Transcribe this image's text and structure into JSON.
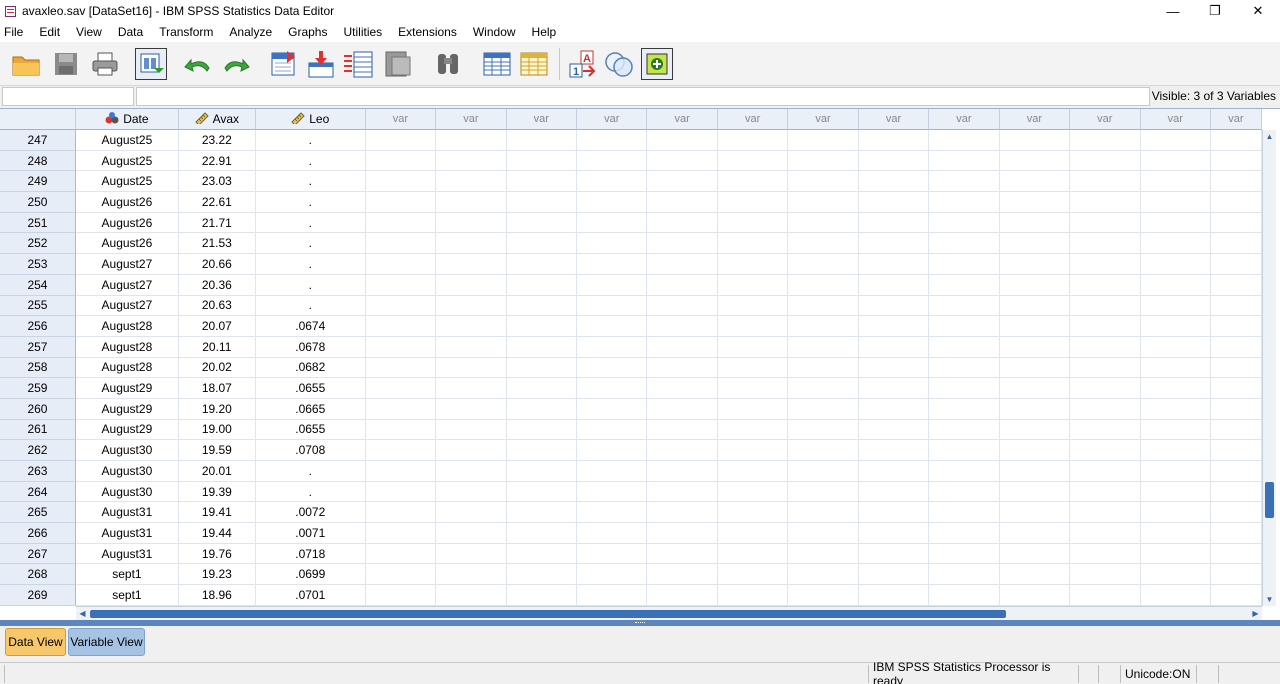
{
  "window": {
    "title": "avaxleo.sav [DataSet16] - IBM SPSS Statistics Data Editor",
    "controls": [
      "—",
      "❐",
      "✕"
    ]
  },
  "menu": [
    "File",
    "Edit",
    "View",
    "Data",
    "Transform",
    "Analyze",
    "Graphs",
    "Utilities",
    "Extensions",
    "Window",
    "Help"
  ],
  "toolbar": {
    "icons": [
      "open-folder-icon",
      "save-icon",
      "print-icon",
      "dialog-recall-icon",
      "undo-icon",
      "redo-icon",
      "go-to-case-icon",
      "go-to-variable-icon",
      "variables-icon",
      "run-descriptives-icon",
      "find-icon",
      "insert-cases-icon",
      "insert-variable-icon",
      "value-labels-icon",
      "use-sets-icon",
      "spelling-icon"
    ]
  },
  "cell_editor": {
    "name_value": "",
    "cell_value": "",
    "visible": "Visible: 3 of 3 Variables"
  },
  "grid": {
    "columns": [
      {
        "name": "Date",
        "icon": "nominal-icon"
      },
      {
        "name": "Avax",
        "icon": "scale-icon"
      },
      {
        "name": "Leo",
        "icon": "scale-icon"
      }
    ],
    "empty_column_label": "var",
    "empty_column_count": 13,
    "rows": [
      {
        "n": "247",
        "date": "August25",
        "avax": "23.22",
        "leo": "."
      },
      {
        "n": "248",
        "date": "August25",
        "avax": "22.91",
        "leo": "."
      },
      {
        "n": "249",
        "date": "August25",
        "avax": "23.03",
        "leo": "."
      },
      {
        "n": "250",
        "date": "August26",
        "avax": "22.61",
        "leo": "."
      },
      {
        "n": "251",
        "date": "August26",
        "avax": "21.71",
        "leo": "."
      },
      {
        "n": "252",
        "date": "August26",
        "avax": "21.53",
        "leo": "."
      },
      {
        "n": "253",
        "date": "August27",
        "avax": "20.66",
        "leo": "."
      },
      {
        "n": "254",
        "date": "August27",
        "avax": "20.36",
        "leo": "."
      },
      {
        "n": "255",
        "date": "August27",
        "avax": "20.63",
        "leo": "."
      },
      {
        "n": "256",
        "date": "August28",
        "avax": "20.07",
        "leo": ".0674"
      },
      {
        "n": "257",
        "date": "August28",
        "avax": "20.11",
        "leo": ".0678"
      },
      {
        "n": "258",
        "date": "August28",
        "avax": "20.02",
        "leo": ".0682"
      },
      {
        "n": "259",
        "date": "August29",
        "avax": "18.07",
        "leo": ".0655"
      },
      {
        "n": "260",
        "date": "August29",
        "avax": "19.20",
        "leo": ".0665"
      },
      {
        "n": "261",
        "date": "August29",
        "avax": "19.00",
        "leo": ".0655"
      },
      {
        "n": "262",
        "date": "August30",
        "avax": "19.59",
        "leo": ".0708"
      },
      {
        "n": "263",
        "date": "August30",
        "avax": "20.01",
        "leo": "."
      },
      {
        "n": "264",
        "date": "August30",
        "avax": "19.39",
        "leo": "."
      },
      {
        "n": "265",
        "date": "August31",
        "avax": "19.41",
        "leo": ".0072"
      },
      {
        "n": "266",
        "date": "August31",
        "avax": "19.44",
        "leo": ".0071"
      },
      {
        "n": "267",
        "date": "August31",
        "avax": "19.76",
        "leo": ".0718"
      },
      {
        "n": "268",
        "date": "sept1",
        "avax": "19.23",
        "leo": ".0699"
      },
      {
        "n": "269",
        "date": "sept1",
        "avax": "18.96",
        "leo": ".0701"
      }
    ]
  },
  "scroll": {
    "vertical_position": 0.82,
    "horizontal_visible_fraction": 0.79
  },
  "tabs": [
    {
      "label": "Data View",
      "active": true
    },
    {
      "label": "Variable View",
      "active": false
    }
  ],
  "status": {
    "processor": "IBM SPSS Statistics Processor is ready",
    "unicode": "Unicode:ON"
  }
}
